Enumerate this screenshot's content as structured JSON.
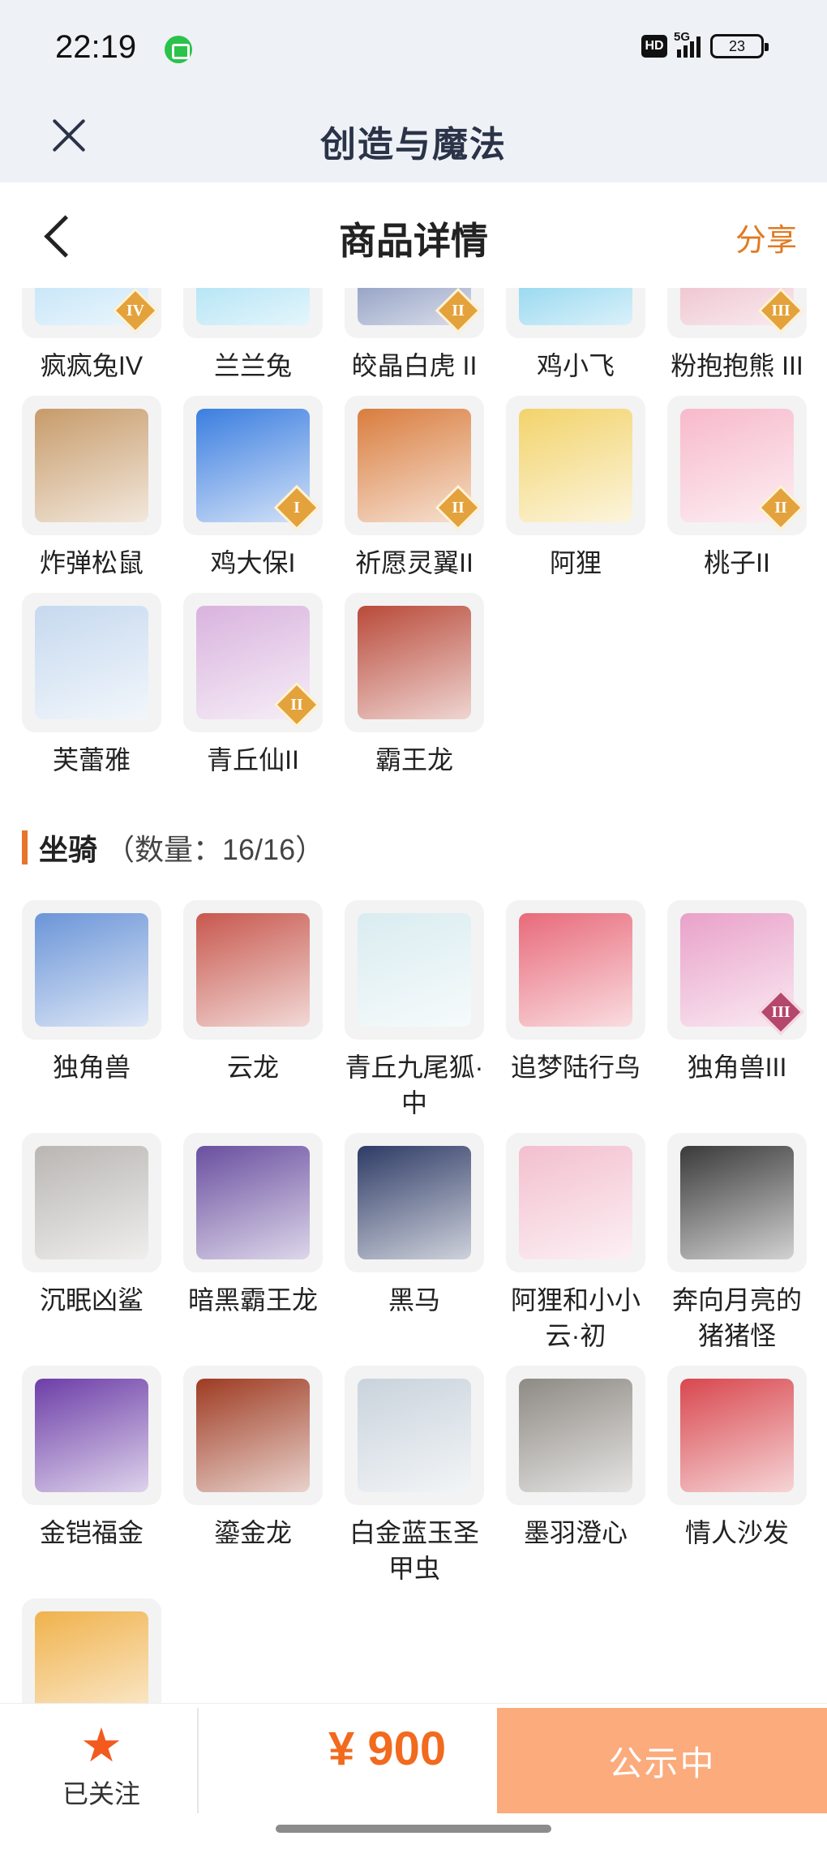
{
  "status_bar": {
    "time": "22:19",
    "hd": "HD",
    "network": "5G",
    "battery": "23"
  },
  "app_header": {
    "title": "创造与魔法"
  },
  "page": {
    "title": "商品详情",
    "share_label": "分享"
  },
  "pets": [
    {
      "name": "疯疯兔IV",
      "tier": "IV",
      "color": "#a9d8f5"
    },
    {
      "name": "兰兰兔",
      "tier": "",
      "color": "#8cd6f0"
    },
    {
      "name": "皎晶白虎 II",
      "tier": "II",
      "color": "#5b6fa6"
    },
    {
      "name": "鸡小飞",
      "tier": "",
      "color": "#5fc3e8"
    },
    {
      "name": "粉抱抱熊 III",
      "tier": "III",
      "color": "#e6a6b8"
    },
    {
      "name": "炸弹松鼠",
      "tier": "",
      "color": "#c79b6a"
    },
    {
      "name": "鸡大保I",
      "tier": "I",
      "color": "#3b7ee0"
    },
    {
      "name": "祈愿灵翼II",
      "tier": "II",
      "color": "#d97d3e"
    },
    {
      "name": "阿狸",
      "tier": "",
      "color": "#f2d36b"
    },
    {
      "name": "桃子II",
      "tier": "II",
      "color": "#f7b9cc"
    },
    {
      "name": "芙蕾雅",
      "tier": "",
      "color": "#c6d9ef"
    },
    {
      "name": "青丘仙II",
      "tier": "II",
      "color": "#d9b3de"
    },
    {
      "name": "霸王龙",
      "tier": "",
      "color": "#b94a3a"
    }
  ],
  "mounts_section": {
    "title": "坐骑",
    "count": "（数量：16/16）"
  },
  "mounts": [
    {
      "name": "独角兽",
      "tier": "",
      "color": "#6b95d8"
    },
    {
      "name": "云龙",
      "tier": "",
      "color": "#c7584e"
    },
    {
      "name": "青丘九尾狐·中",
      "tier": "",
      "color": "#d9ecf0"
    },
    {
      "name": "追梦陆行鸟",
      "tier": "",
      "color": "#e86a7a"
    },
    {
      "name": "独角兽III",
      "tier": "III",
      "color": "#e9a1c9"
    },
    {
      "name": "沉眠凶鲨",
      "tier": "",
      "color": "#b9b6b3"
    },
    {
      "name": "暗黑霸王龙",
      "tier": "",
      "color": "#6a4fa0"
    },
    {
      "name": "黑马",
      "tier": "",
      "color": "#2e3b66"
    },
    {
      "name": "阿狸和小小云·初",
      "tier": "",
      "color": "#f3bfcf"
    },
    {
      "name": "奔向月亮的猪猪怪",
      "tier": "",
      "color": "#3a3a3a"
    },
    {
      "name": "金铠福金",
      "tier": "",
      "color": "#6d3ea8"
    },
    {
      "name": "鎏金龙",
      "tier": "",
      "color": "#9e3b22"
    },
    {
      "name": "白金蓝玉圣甲虫",
      "tier": "",
      "color": "#c9d3dc"
    },
    {
      "name": "墨羽澄心",
      "tier": "",
      "color": "#8e8a84"
    },
    {
      "name": "情人沙发",
      "tier": "",
      "color": "#d8474e"
    },
    {
      "name": "",
      "tier": "",
      "color": "#f0b24c"
    }
  ],
  "bottom_bar": {
    "follow_label": "已关注",
    "price": "¥ 900",
    "status_label": "公示中"
  }
}
